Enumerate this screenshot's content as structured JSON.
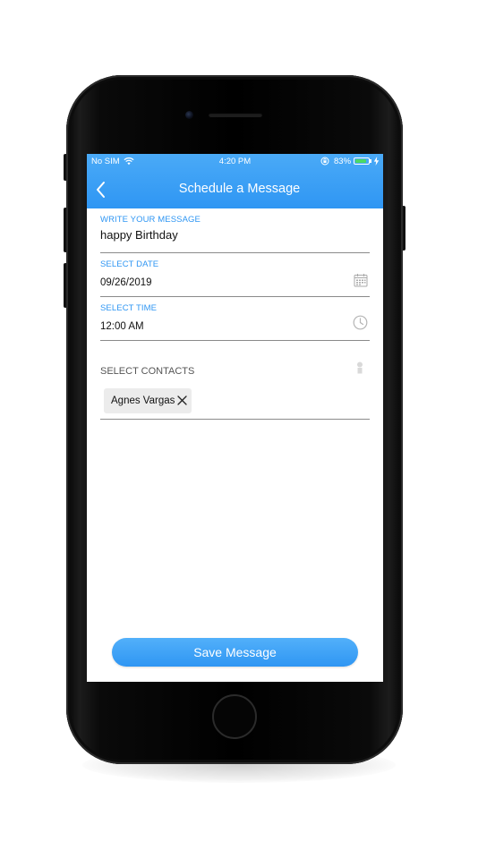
{
  "status_bar": {
    "carrier": "No SIM",
    "time": "4:20 PM",
    "battery_percent": "83%",
    "battery_level": 0.83,
    "icons": [
      "wifi-icon",
      "orientation-lock-icon",
      "battery-icon",
      "charging-bolt-icon"
    ]
  },
  "nav": {
    "back_icon": "chevron-left-icon",
    "title": "Schedule a Message"
  },
  "form": {
    "message": {
      "label": "WRITE YOUR MESSAGE",
      "value": "happy Birthday"
    },
    "date": {
      "label": "SELECT DATE",
      "value": "09/26/2019",
      "icon": "calendar-icon"
    },
    "time": {
      "label": "SELECT TIME",
      "value": "12:00 AM",
      "icon": "clock-icon"
    },
    "contacts": {
      "label": "SELECT CONTACTS",
      "icon": "person-icon",
      "selected": [
        {
          "name": "Agnes Vargas",
          "remove_icon": "close-icon"
        }
      ]
    }
  },
  "actions": {
    "save_label": "Save Message"
  },
  "colors": {
    "accent": "#2f96f3",
    "header_gradient_top": "#4aaaf7",
    "chip_background": "#ececec",
    "battery_fill": "#4cd964"
  }
}
